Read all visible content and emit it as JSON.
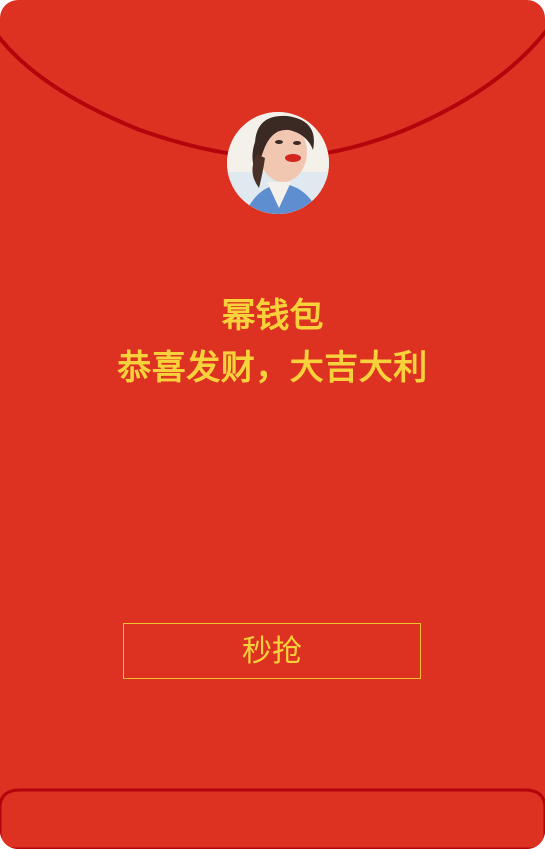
{
  "envelope": {
    "sender_name": "幂钱包",
    "greeting": "恭喜发财，大吉大利",
    "grab_label": "秒抢",
    "avatar_icon": "user-avatar-photo"
  },
  "colors": {
    "background": "#dd3122",
    "text_gold": "#f8d23a",
    "string": "#b4040c",
    "button_border": "#f0c232"
  }
}
